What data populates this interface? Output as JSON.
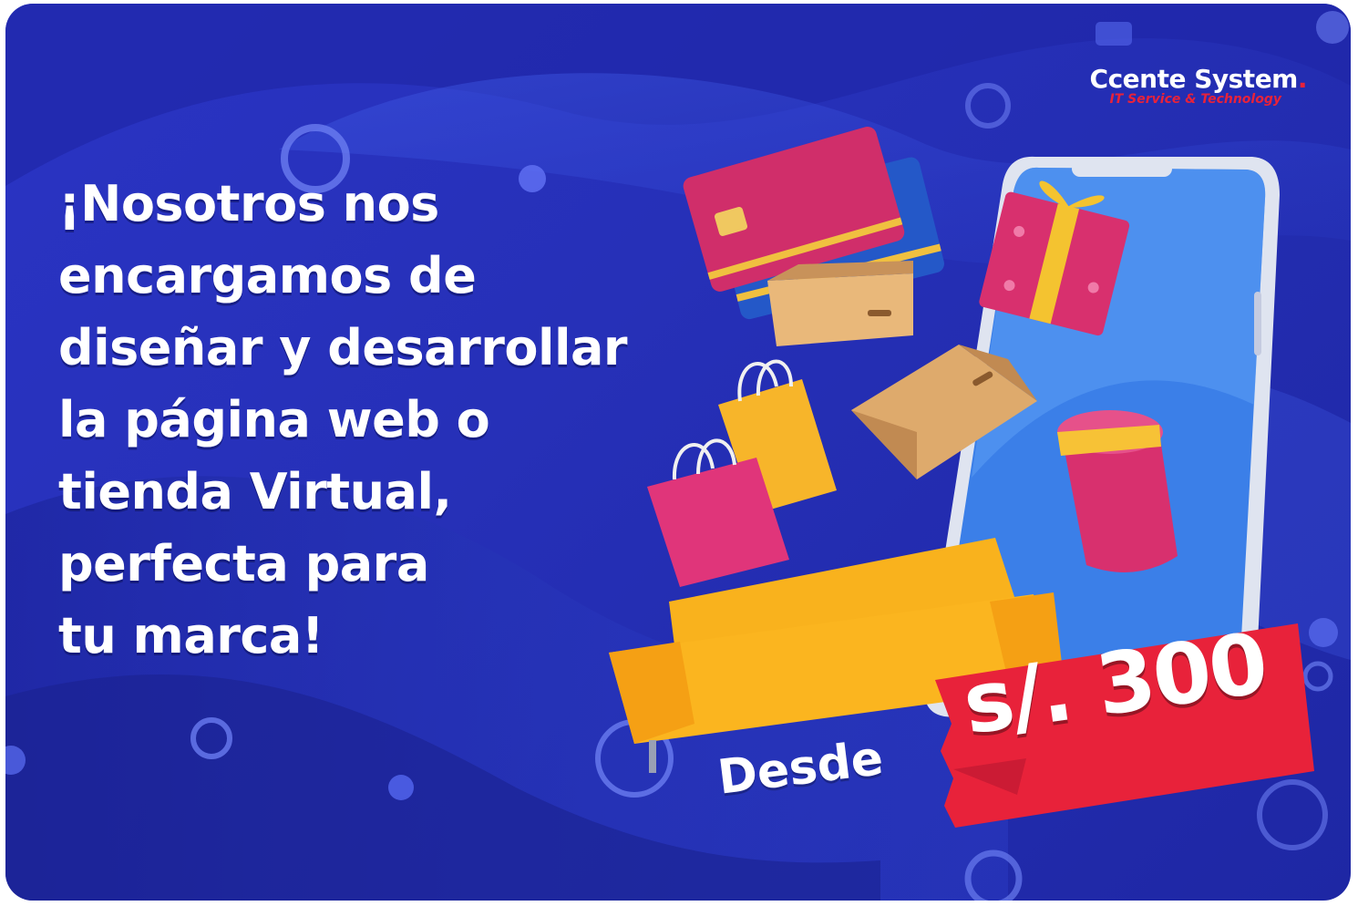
{
  "brand": {
    "name": "Ccente System",
    "tagline": "IT Service & Technology",
    "accent_color": "#e8223a"
  },
  "headline_lines": [
    "¡Nosotros nos",
    "encargamos de",
    "diseñar y desarrollar",
    "la página web o",
    "tienda Virtual,",
    "perfecta para",
    "tu marca!"
  ],
  "offer": {
    "prefix": "Desde",
    "price": "s/. 300"
  },
  "colors": {
    "background": "#2630b8",
    "price_tag": "#e8223a",
    "sofa": "#f9b21d",
    "phone_screen": "#3b7fe8"
  },
  "illustration_icons": [
    "credit-card-icon",
    "gift-box-icon",
    "cardboard-box-icon",
    "shopping-bag-icon",
    "sofa-icon",
    "smartphone-icon",
    "hat-box-icon"
  ]
}
